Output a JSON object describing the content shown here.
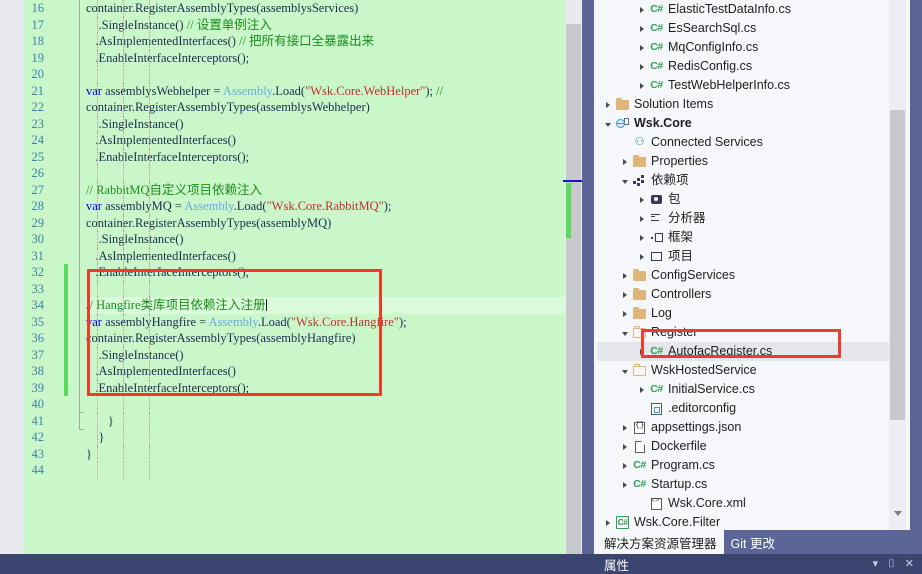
{
  "editor": {
    "first_line_number": 16,
    "current_line_number": 34,
    "lines": [
      {
        "n": "16",
        "segs": [
          {
            "t": "container.RegisterAssemblyTypes(assemblysServices)",
            "c": "pln"
          }
        ]
      },
      {
        "n": "17",
        "segs": [
          {
            "t": "    .SingleInstance() ",
            "c": "pln"
          },
          {
            "t": "// 设置单例注入",
            "c": "cmt"
          }
        ]
      },
      {
        "n": "18",
        "segs": [
          {
            "t": "   .AsImplementedInterfaces() ",
            "c": "pln"
          },
          {
            "t": "// 把所有接口全暴露出来",
            "c": "cmt"
          }
        ]
      },
      {
        "n": "19",
        "segs": [
          {
            "t": "   .EnableInterfaceInterceptors();",
            "c": "pln"
          }
        ]
      },
      {
        "n": "20",
        "segs": [
          {
            "t": "",
            "c": "pln"
          }
        ]
      },
      {
        "n": "21",
        "segs": [
          {
            "t": "var",
            "c": "kw"
          },
          {
            "t": " assemblysWebhelper = ",
            "c": "pln"
          },
          {
            "t": "Assembly",
            "c": "type"
          },
          {
            "t": ".Load(",
            "c": "pln"
          },
          {
            "t": "\"Wsk.Core.WebHelper\"",
            "c": "str"
          },
          {
            "t": "); ",
            "c": "pln"
          },
          {
            "t": "//",
            "c": "cmt"
          }
        ]
      },
      {
        "n": "22",
        "segs": [
          {
            "t": "container.RegisterAssemblyTypes(assemblysWebhelper)",
            "c": "pln"
          }
        ]
      },
      {
        "n": "23",
        "segs": [
          {
            "t": "    .SingleInstance()",
            "c": "pln"
          }
        ]
      },
      {
        "n": "24",
        "segs": [
          {
            "t": "   .AsImplementedInterfaces()",
            "c": "pln"
          }
        ]
      },
      {
        "n": "25",
        "segs": [
          {
            "t": "   .EnableInterfaceInterceptors();",
            "c": "pln"
          }
        ]
      },
      {
        "n": "26",
        "segs": [
          {
            "t": "",
            "c": "pln"
          }
        ]
      },
      {
        "n": "27",
        "segs": [
          {
            "t": "// RabbitMQ自定义项目依赖注入",
            "c": "cmt"
          }
        ]
      },
      {
        "n": "28",
        "segs": [
          {
            "t": "var",
            "c": "kw"
          },
          {
            "t": " assemblyMQ = ",
            "c": "pln"
          },
          {
            "t": "Assembly",
            "c": "type"
          },
          {
            "t": ".Load(",
            "c": "pln"
          },
          {
            "t": "\"Wsk.Core.RabbitMQ\"",
            "c": "str"
          },
          {
            "t": ");",
            "c": "pln"
          }
        ]
      },
      {
        "n": "29",
        "segs": [
          {
            "t": "container.RegisterAssemblyTypes(assemblyMQ)",
            "c": "pln"
          }
        ]
      },
      {
        "n": "30",
        "segs": [
          {
            "t": "    .SingleInstance()",
            "c": "pln"
          }
        ]
      },
      {
        "n": "31",
        "segs": [
          {
            "t": "   .AsImplementedInterfaces()",
            "c": "pln"
          }
        ]
      },
      {
        "n": "32",
        "segs": [
          {
            "t": "   .EnableInterfaceInterceptors();",
            "c": "pln"
          }
        ]
      },
      {
        "n": "33",
        "segs": [
          {
            "t": "",
            "c": "pln"
          }
        ]
      },
      {
        "n": "34",
        "segs": [
          {
            "t": "// Hangfire类库项目依赖注入注册",
            "c": "cmt"
          }
        ],
        "caret": true,
        "current": true
      },
      {
        "n": "35",
        "segs": [
          {
            "t": "var",
            "c": "kw"
          },
          {
            "t": " assemblyHangfire = ",
            "c": "pln"
          },
          {
            "t": "Assembly",
            "c": "type"
          },
          {
            "t": ".Load(",
            "c": "pln"
          },
          {
            "t": "\"Wsk.Core.Hangfire\"",
            "c": "str"
          },
          {
            "t": ");",
            "c": "pln"
          }
        ]
      },
      {
        "n": "36",
        "segs": [
          {
            "t": "container.RegisterAssemblyTypes(assemblyHangfire)",
            "c": "pln"
          }
        ]
      },
      {
        "n": "37",
        "segs": [
          {
            "t": "    .SingleInstance()",
            "c": "pln"
          }
        ]
      },
      {
        "n": "38",
        "segs": [
          {
            "t": "   .AsImplementedInterfaces()",
            "c": "pln"
          }
        ]
      },
      {
        "n": "39",
        "segs": [
          {
            "t": "   .EnableInterfaceInterceptors();",
            "c": "pln"
          }
        ]
      },
      {
        "n": "40",
        "segs": [
          {
            "t": "",
            "c": "pln"
          }
        ]
      },
      {
        "n": "41",
        "segs": [
          {
            "t": "       }",
            "c": "brace"
          }
        ]
      },
      {
        "n": "42",
        "segs": [
          {
            "t": "    }",
            "c": "brace"
          }
        ]
      },
      {
        "n": "43",
        "segs": [
          {
            "t": "}",
            "c": "brace"
          }
        ]
      },
      {
        "n": "44",
        "segs": [
          {
            "t": "",
            "c": "pln"
          }
        ]
      }
    ],
    "annotation": {
      "shape": "rectangle",
      "color": "#ef3a2d",
      "covers": "lines 34-40 Hangfire registration block"
    },
    "change_marker_color": "#5bd95b",
    "background_color": "#c9f7c9"
  },
  "solution_explorer": {
    "scroll_down_glyph": "▼",
    "tree": [
      {
        "indent": 3,
        "arrow": "closed",
        "icon": "cs-icon",
        "label": "ElasticTestDataInfo.cs"
      },
      {
        "indent": 3,
        "arrow": "closed",
        "icon": "cs-icon",
        "label": "EsSearchSql.cs"
      },
      {
        "indent": 3,
        "arrow": "closed",
        "icon": "cs-icon",
        "label": "MqConfigInfo.cs"
      },
      {
        "indent": 3,
        "arrow": "closed",
        "icon": "cs-icon",
        "label": "RedisConfig.cs"
      },
      {
        "indent": 3,
        "arrow": "closed",
        "icon": "cs-icon",
        "label": "TestWebHelperInfo.cs"
      },
      {
        "indent": 1,
        "arrow": "closed",
        "icon": "folder-icon",
        "label": "Solution Items"
      },
      {
        "indent": 1,
        "arrow": "open",
        "icon": "project-icon",
        "label": "Wsk.Core",
        "bold": true
      },
      {
        "indent": 2,
        "arrow": "none",
        "icon": "connected-services-icon",
        "label": "Connected Services"
      },
      {
        "indent": 2,
        "arrow": "closed",
        "icon": "properties-folder-icon",
        "label": "Properties"
      },
      {
        "indent": 2,
        "arrow": "open",
        "icon": "dependencies-icon",
        "label": "依赖项"
      },
      {
        "indent": 3,
        "arrow": "closed",
        "icon": "package-icon",
        "label": "包"
      },
      {
        "indent": 3,
        "arrow": "closed",
        "icon": "analyzer-icon",
        "label": "分析器"
      },
      {
        "indent": 3,
        "arrow": "closed",
        "icon": "framework-icon",
        "label": "框架"
      },
      {
        "indent": 3,
        "arrow": "closed",
        "icon": "projects-icon",
        "label": "项目"
      },
      {
        "indent": 2,
        "arrow": "closed",
        "icon": "folder-icon",
        "label": "ConfigServices"
      },
      {
        "indent": 2,
        "arrow": "closed",
        "icon": "folder-icon",
        "label": "Controllers"
      },
      {
        "indent": 2,
        "arrow": "closed",
        "icon": "folder-icon",
        "label": "Log"
      },
      {
        "indent": 2,
        "arrow": "open",
        "icon": "folder-open-icon",
        "label": "Register"
      },
      {
        "indent": 3,
        "arrow": "closed",
        "icon": "cs-icon",
        "label": "AutofacRegister.cs",
        "selected": true
      },
      {
        "indent": 2,
        "arrow": "open",
        "icon": "folder-open-icon",
        "label": "WskHostedService"
      },
      {
        "indent": 3,
        "arrow": "closed",
        "icon": "cs-icon",
        "label": "InitialService.cs"
      },
      {
        "indent": 3,
        "arrow": "none",
        "icon": "editorconfig-icon",
        "label": ".editorconfig"
      },
      {
        "indent": 2,
        "arrow": "closed",
        "icon": "json-icon",
        "label": "appsettings.json"
      },
      {
        "indent": 2,
        "arrow": "closed",
        "icon": "file-icon",
        "label": "Dockerfile"
      },
      {
        "indent": 2,
        "arrow": "closed",
        "icon": "cs-icon",
        "label": "Program.cs"
      },
      {
        "indent": 2,
        "arrow": "closed",
        "icon": "cs-icon",
        "label": "Startup.cs"
      },
      {
        "indent": 3,
        "arrow": "none",
        "icon": "xml-icon",
        "label": "Wsk.Core.xml"
      },
      {
        "indent": 1,
        "arrow": "closed",
        "icon": "cs-project-icon",
        "label": "Wsk.Core.Filter"
      }
    ],
    "annotation": {
      "shape": "rectangle",
      "color": "#ef3a2d",
      "covers": "AutofacRegister.cs"
    },
    "tabs": [
      {
        "label": "解决方案资源管理器",
        "active": true
      },
      {
        "label": "Git 更改",
        "active": false
      }
    ]
  },
  "properties_bar": {
    "title": "属性",
    "icons": [
      "chevron-down-icon",
      "pin-icon",
      "close-icon"
    ],
    "glyphs": {
      "chevron": "▾",
      "pin": "⌷",
      "close": "✕"
    }
  },
  "colors": {
    "editor_background": "#c9f7c9",
    "current_line": "#d9fbd9",
    "annotation_red": "#ef3a2d",
    "chrome_blue": "#5b6597",
    "properties_bar": "#3c4570",
    "keyword": "#0000d0",
    "type": "#6fa8dc",
    "string": "#c03030",
    "comment": "#1f8a1f",
    "line_number": "#3f80a8"
  }
}
